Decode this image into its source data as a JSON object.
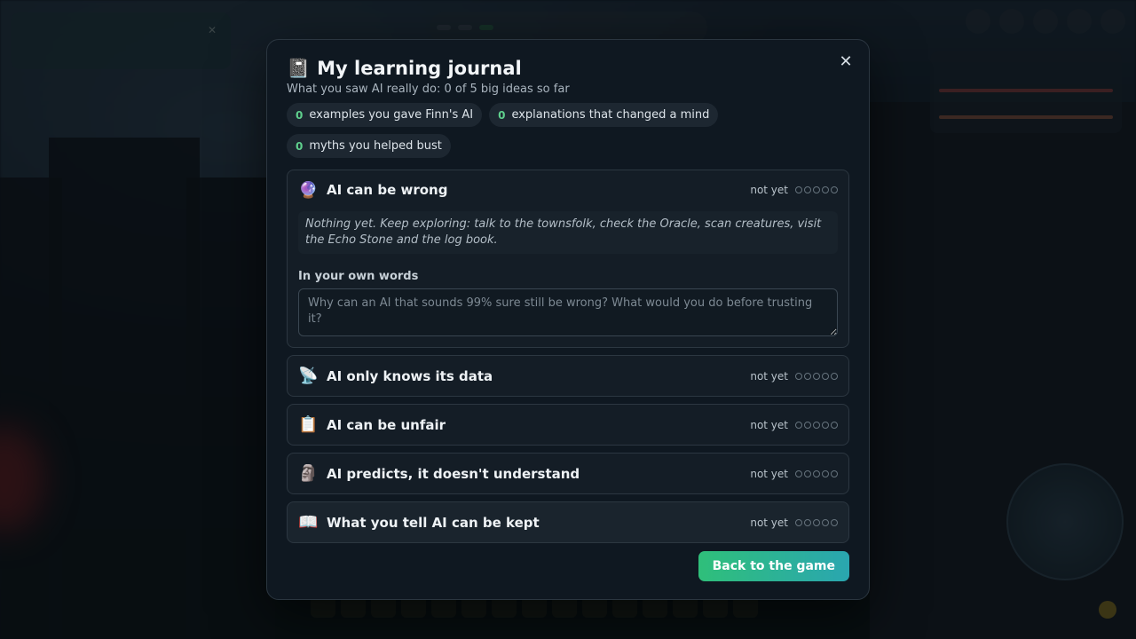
{
  "journal": {
    "title_icon": "📓",
    "title": "My learning journal",
    "subtitle": "What you saw AI really do: 0 of 5 big ideas so far",
    "close_label": "✕",
    "stats": [
      {
        "count": "0",
        "label": "examples you gave Finn's AI"
      },
      {
        "count": "0",
        "label": "explanations that changed a mind"
      },
      {
        "count": "0",
        "label": "myths you helped bust"
      }
    ],
    "ideas": [
      {
        "icon": "🔮",
        "icon_name": "crystal-ball-icon",
        "title": "AI can be wrong",
        "status": "not yet",
        "progress": 0,
        "progress_max": 5,
        "expanded": true,
        "note": "Nothing yet. Keep exploring: talk to the townsfolk, check the Oracle, scan creatures, visit the Echo Stone and the log book.",
        "own_words_label": "In your own words",
        "own_words_placeholder": "Why can an AI that sounds 99% sure still be wrong? What would you do before trusting it?",
        "own_words_value": ""
      },
      {
        "icon": "📡",
        "icon_name": "satellite-dish-icon",
        "title": "AI only knows its data",
        "status": "not yet",
        "progress": 0,
        "progress_max": 5
      },
      {
        "icon": "📋",
        "icon_name": "clipboard-icon",
        "title": "AI can be unfair",
        "status": "not yet",
        "progress": 0,
        "progress_max": 5
      },
      {
        "icon": "🗿",
        "icon_name": "moai-icon",
        "title": "AI predicts, it doesn't understand",
        "status": "not yet",
        "progress": 0,
        "progress_max": 5
      },
      {
        "icon": "📖",
        "icon_name": "open-book-icon",
        "title": "What you tell AI can be kept",
        "status": "not yet",
        "progress": 0,
        "progress_max": 5
      }
    ],
    "back_button": "Back to the game"
  },
  "colors": {
    "accent_green": "#5fd08d",
    "button_gradient_start": "#2fbf7a",
    "button_gradient_end": "#2aa6b0",
    "modal_bg": "#0f1821"
  }
}
